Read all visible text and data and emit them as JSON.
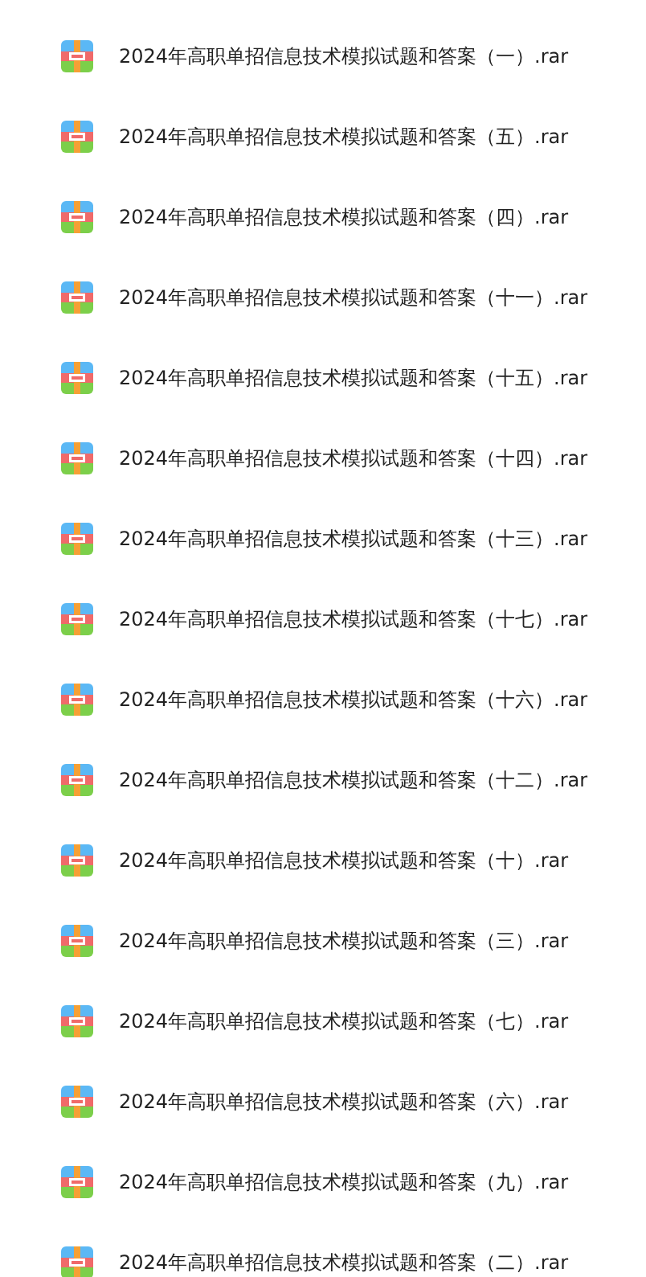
{
  "files": [
    {
      "name": "2024年高职单招信息技术模拟试题和答案（一）.rar"
    },
    {
      "name": "2024年高职单招信息技术模拟试题和答案（五）.rar"
    },
    {
      "name": "2024年高职单招信息技术模拟试题和答案（四）.rar"
    },
    {
      "name": "2024年高职单招信息技术模拟试题和答案（十一）.rar"
    },
    {
      "name": "2024年高职单招信息技术模拟试题和答案（十五）.rar"
    },
    {
      "name": "2024年高职单招信息技术模拟试题和答案（十四）.rar"
    },
    {
      "name": "2024年高职单招信息技术模拟试题和答案（十三）.rar"
    },
    {
      "name": "2024年高职单招信息技术模拟试题和答案（十七）.rar"
    },
    {
      "name": "2024年高职单招信息技术模拟试题和答案（十六）.rar"
    },
    {
      "name": "2024年高职单招信息技术模拟试题和答案（十二）.rar"
    },
    {
      "name": "2024年高职单招信息技术模拟试题和答案（十）.rar"
    },
    {
      "name": "2024年高职单招信息技术模拟试题和答案（三）.rar"
    },
    {
      "name": "2024年高职单招信息技术模拟试题和答案（七）.rar"
    },
    {
      "name": "2024年高职单招信息技术模拟试题和答案（六）.rar"
    },
    {
      "name": "2024年高职单招信息技术模拟试题和答案（九）.rar"
    },
    {
      "name": "2024年高职单招信息技术模拟试题和答案（二）.rar"
    }
  ]
}
